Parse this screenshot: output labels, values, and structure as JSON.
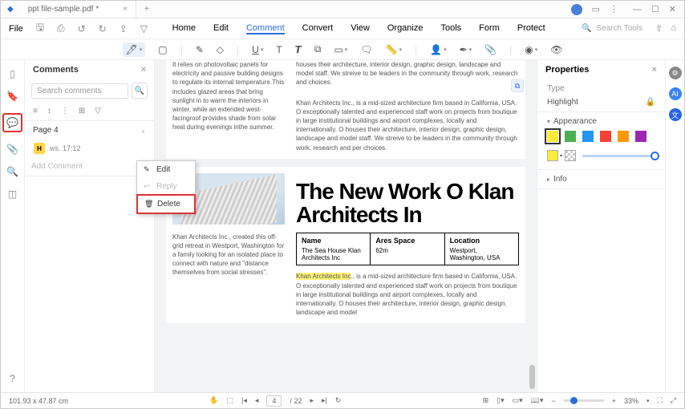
{
  "titlebar": {
    "tab_name": "ppt file-sample.pdf *"
  },
  "menubar": {
    "file": "File",
    "items": [
      "Home",
      "Edit",
      "Comment",
      "Convert",
      "View",
      "Organize",
      "Tools",
      "Form",
      "Protect"
    ],
    "active_index": 2,
    "search_placeholder": "Search Tools"
  },
  "comments": {
    "title": "Comments",
    "search_placeholder": "Search comments",
    "page_label": "Page 4",
    "item_badge": "H",
    "item_meta": "ws.   17:12",
    "add_placeholder": "Add Comment"
  },
  "context_menu": {
    "edit": "Edit",
    "reply": "Reply",
    "delete": "Delete"
  },
  "document": {
    "col1_top": "It relies on photovoltaic panels for electricity and passive building designs to regulate its internal temperature.This includes glazed areas that bring sunlight in to warm the interiors in winter, while an extended west-facingroof provides shade from solar heat during evenings inthe summer.",
    "col2_top": "houses their architecture, interior design, graphic design, landscape and model staff. We streive to be leaders in the community through work, research and choices.",
    "col2_para": "Khan Architects Inc., is a mid-sized architecture firm based in California, USA. O exceptionally talented and experienced staff work on projects from boutique in large institutional buildings and airport complexes, locally and internationally. O houses their architecture, interior design, graphic design, landscape and model staff. We streive to be leaders in the community through work, research and per choices.",
    "heading": "The New Work O Klan Architects In",
    "table": {
      "h1": "Name",
      "v1": "The Sea House Klan Architects Inc",
      "h2": "Ares Space",
      "v2": "62m",
      "h3": "Location",
      "v3": "Westport, Washington, USA"
    },
    "col1_bottom": "Khan Architects Inc., created this off-grid retreat in Westport, Washington for a family looking for an isolated place to connect with nature and \"distance themselves from social stresses\".",
    "col2_bottom_hl": "Khan Architects Inc",
    "col2_bottom": "., is a mid-sized architecture firm based in California, USA. O exceptionally talented and experienced staff work on projects from boutique in large institutional buildings and airport complexes, locally and internationally. O houses their architecture, interior design, graphic design, landscape and model"
  },
  "properties": {
    "title": "Properties",
    "type_label": "Type",
    "type_value": "Highlight",
    "appearance": "Appearance",
    "info": "Info",
    "swatches": [
      "#ffeb3b",
      "#4caf50",
      "#2196f3",
      "#f44336",
      "#ff9800",
      "#9c27b0"
    ],
    "active_swatch": 0
  },
  "statusbar": {
    "coords": "101.93 x 47.87 cm",
    "page": "4",
    "page_total": "22",
    "zoom": "33%"
  }
}
